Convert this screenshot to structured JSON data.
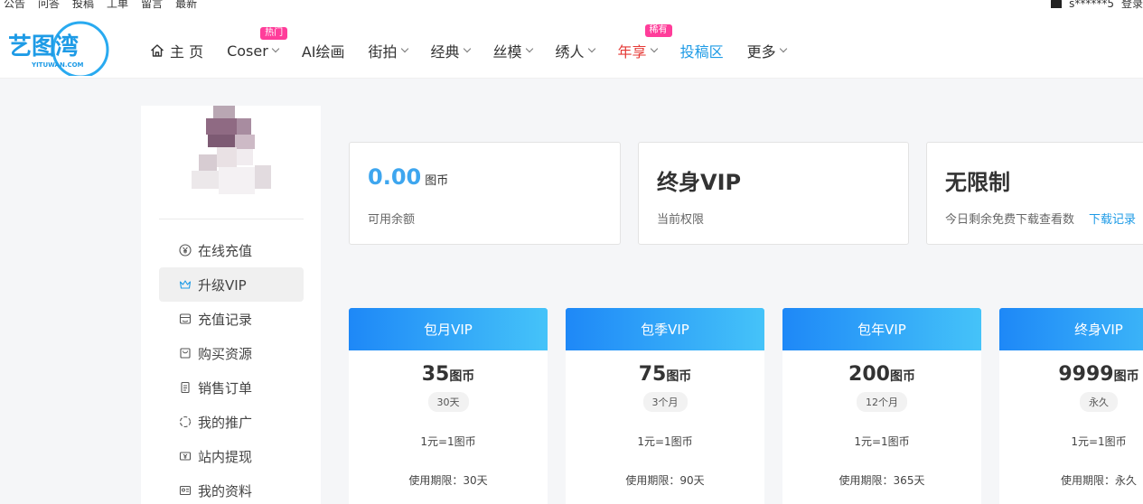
{
  "topbar": {
    "links": [
      "公告",
      "问答",
      "投稿",
      "工单",
      "留言",
      "最新"
    ],
    "user": "s******5",
    "login": "登录"
  },
  "logo": {
    "text": "艺图湾",
    "sub": "YITUWAN.COM",
    "color": "#1e9be6"
  },
  "nav": {
    "items": [
      {
        "label": "主 页",
        "icon": "home-icon"
      },
      {
        "label": "Coser",
        "badge": "热门"
      },
      {
        "label": "AI绘画"
      },
      {
        "label": "街拍"
      },
      {
        "label": "经典"
      },
      {
        "label": "丝模"
      },
      {
        "label": "绣人"
      },
      {
        "label": "年享",
        "badge": "稀有"
      },
      {
        "label": "投稿区"
      },
      {
        "label": "更多"
      }
    ]
  },
  "sidebar": {
    "menu": [
      {
        "label": "在线充值",
        "icon": "yen-icon"
      },
      {
        "label": "升级VIP",
        "icon": "crown-icon"
      },
      {
        "label": "充值记录",
        "icon": "wallet-icon"
      },
      {
        "label": "购买资源",
        "icon": "bag-icon"
      },
      {
        "label": "销售订单",
        "icon": "order-icon"
      },
      {
        "label": "我的推广",
        "icon": "share-icon"
      },
      {
        "label": "站内提现",
        "icon": "withdraw-icon"
      },
      {
        "label": "我的资料",
        "icon": "profile-icon"
      }
    ]
  },
  "stats": {
    "balance": {
      "value": "0.00",
      "unit": "图币",
      "label": "可用余额"
    },
    "rights": {
      "value": "终身VIP",
      "label": "当前权限"
    },
    "downloads": {
      "value": "无限制",
      "label": "今日剩余免费下载查看数",
      "link": "下载记录"
    }
  },
  "plans": [
    {
      "name": "包月VIP",
      "price": "35",
      "unit": "图币",
      "tag": "30天",
      "rate": "1元=1图币",
      "term": "使用期限：30天"
    },
    {
      "name": "包季VIP",
      "price": "75",
      "unit": "图币",
      "tag": "3个月",
      "rate": "1元=1图币",
      "term": "使用期限：90天"
    },
    {
      "name": "包年VIP",
      "price": "200",
      "unit": "图币",
      "tag": "12个月",
      "rate": "1元=1图币",
      "term": "使用期限：365天"
    },
    {
      "name": "终身VIP",
      "price": "9999",
      "unit": "图币",
      "tag": "永久",
      "rate": "1元=1图币",
      "term": "使用期限：永久"
    }
  ],
  "colors": {
    "accent": "#1e9be6",
    "badge": "#ff3d9a",
    "red": "#e53935"
  }
}
